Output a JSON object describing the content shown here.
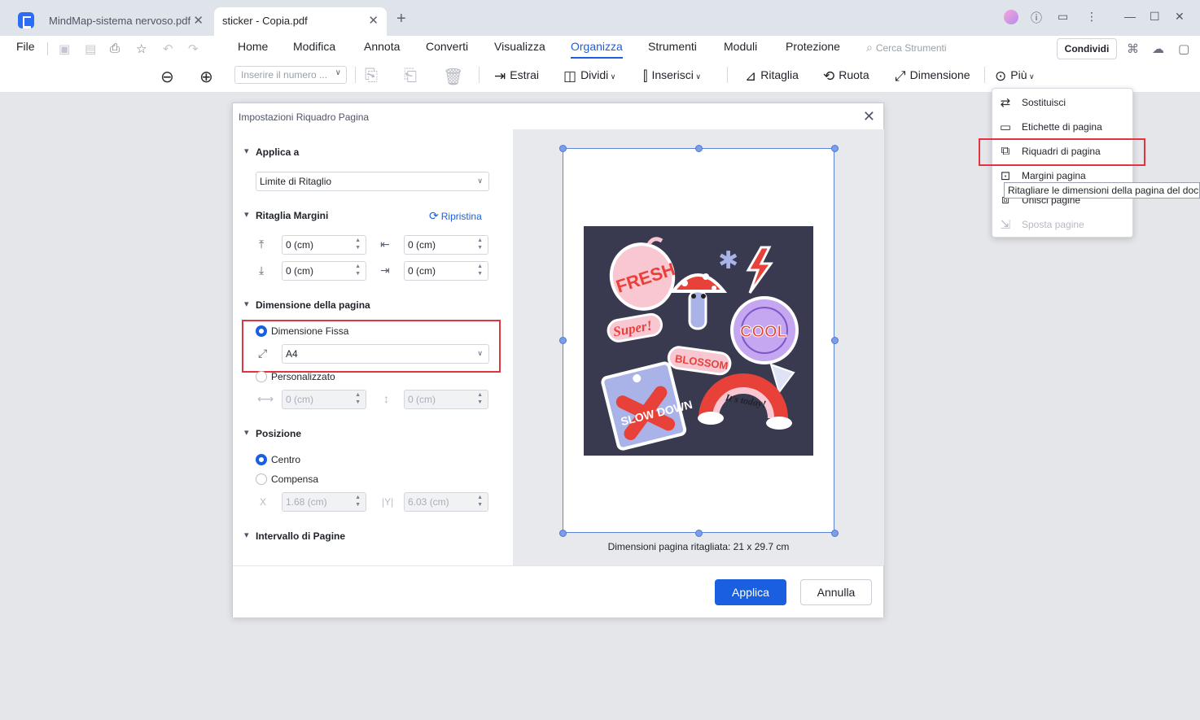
{
  "tabs": [
    {
      "label": "MindMap-sistema nervoso.pdf"
    },
    {
      "label": "sticker - Copia.pdf"
    }
  ],
  "menu": {
    "file": "File",
    "items": [
      "Home",
      "Modifica",
      "Annota",
      "Converti",
      "Visualizza",
      "Organizza",
      "Strumenti",
      "Moduli",
      "Protezione"
    ],
    "search_placeholder": "Cerca Strumenti",
    "share": "Condividi"
  },
  "toolbar": {
    "page_input_placeholder": "Inserire il numero ...",
    "extract": "Estrai",
    "split": "Dividi",
    "insert": "Inserisci",
    "crop": "Ritaglia",
    "rotate": "Ruota",
    "size": "Dimensione",
    "more": "Più"
  },
  "dropdown": {
    "items": [
      {
        "label": "Sostituisci",
        "disabled": false
      },
      {
        "label": "Etichette di pagina",
        "disabled": false
      },
      {
        "label": "Riquadri di pagina",
        "disabled": false
      },
      {
        "label": "Margini pagina",
        "disabled": false
      },
      {
        "label": "Unisci pagine",
        "disabled": false
      },
      {
        "label": "Sposta pagine",
        "disabled": true
      }
    ],
    "tooltip": "Ritagliare le dimensioni della pagina del docu"
  },
  "dialog": {
    "title": "Impostazioni Riquadro Pagina",
    "apply_to": {
      "section": "Applica a",
      "value": "Limite di Ritaglio"
    },
    "crop_margins": {
      "section": "Ritaglia Margini",
      "reset": "Ripristina",
      "top": "0 (cm)",
      "left": "0 (cm)",
      "bottom": "0 (cm)",
      "right": "0 (cm)"
    },
    "page_size": {
      "section": "Dimensione della pagina",
      "fixed_label": "Dimensione Fissa",
      "fixed_value": "A4",
      "custom_label": "Personalizzato",
      "custom_width": "0 (cm)",
      "custom_height": "0 (cm)"
    },
    "position": {
      "section": "Posizione",
      "center": "Centro",
      "offset": "Compensa",
      "x_label": "X",
      "y_label": "Y",
      "x_value": "1.68 (cm)",
      "y_value": "6.03 (cm)"
    },
    "page_range": {
      "section": "Intervallo di Pagine"
    },
    "preview_caption": "Dimensioni pagina ritagliata: 21 x 29.7 cm",
    "apply_button": "Applica",
    "cancel_button": "Annulla"
  },
  "sticker_texts": {
    "fresh": "FRESH",
    "super": "Super!",
    "cool": "COOL",
    "blossom": "BLOSSOM",
    "slow_down": "SLOW DOWN",
    "its_today": "It's today!"
  },
  "colors": {
    "accent": "#1a5fe0",
    "highlight_red": "#e0353f",
    "artwork_bg": "#393a4f"
  }
}
